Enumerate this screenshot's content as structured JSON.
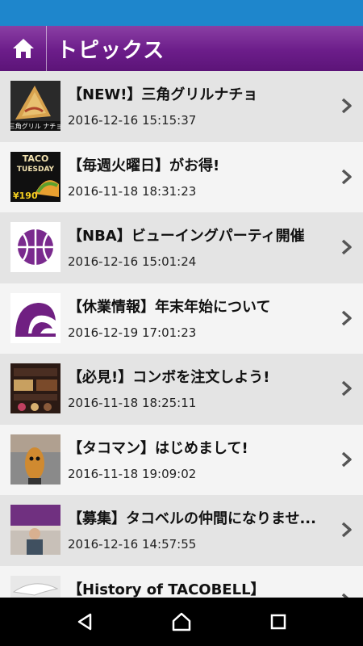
{
  "header": {
    "title": "トピックス",
    "home_icon": "home-icon"
  },
  "topics": [
    {
      "title": "【NEW!】三角グリルナチョ",
      "date": "2016-12-16 15:15:37",
      "thumb": "nacho",
      "thumb_text": "三角グリル ナチョ"
    },
    {
      "title": "【毎週火曜日】がお得!",
      "date": "2016-11-18 18:31:23",
      "thumb": "taco-tuesday",
      "thumb_text_top": "TACO",
      "thumb_text_mid": "TUESDAY",
      "thumb_price": "¥190"
    },
    {
      "title": "【NBA】ビューイングパーティ開催",
      "date": "2016-12-16 15:01:24",
      "thumb": "basketball"
    },
    {
      "title": "【休業情報】年末年始について",
      "date": "2016-12-19 17:01:23",
      "thumb": "tacobell-logo"
    },
    {
      "title": "【必見!】コンボを注文しよう!",
      "date": "2016-11-18 18:25:11",
      "thumb": "combo-menu"
    },
    {
      "title": "【タコマン】はじめまして!",
      "date": "2016-11-18 19:09:02",
      "thumb": "tacoman"
    },
    {
      "title": "【募集】タコベルの仲間になりませ...",
      "date": "2016-12-16 14:57:55",
      "thumb": "recruit"
    },
    {
      "title": "【History of TACOBELL】",
      "date": "",
      "thumb": "history"
    }
  ],
  "nav": {
    "back_icon": "back-icon",
    "home_icon": "home-icon",
    "recent_icon": "recent-apps-icon"
  },
  "colors": {
    "status_bar": "#1e86cc",
    "header": "#6c1d8a",
    "row_odd": "#e4e4e4",
    "row_even": "#f4f4f4",
    "brand_purple": "#702082"
  }
}
